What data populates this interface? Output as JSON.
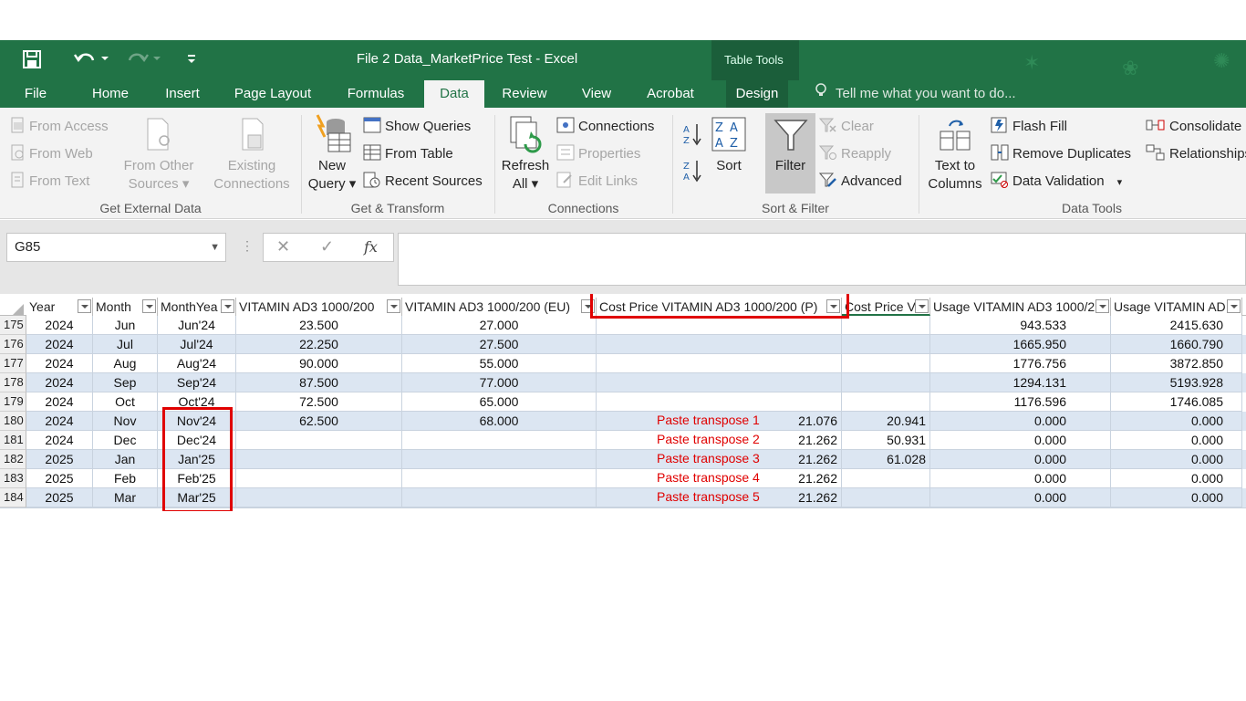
{
  "window": {
    "title": "File 2 Data_MarketPrice Test - Excel",
    "contextual_tab_group": "Table Tools"
  },
  "tabs": [
    "File",
    "Home",
    "Insert",
    "Page Layout",
    "Formulas",
    "Data",
    "Review",
    "View",
    "Acrobat",
    "Design"
  ],
  "active_tab": "Data",
  "tell_me": "Tell me what you want to do...",
  "ribbon": {
    "get_external": {
      "label": "Get External Data",
      "from_access": "From Access",
      "from_web": "From Web",
      "from_text": "From Text",
      "from_other_1": "From Other",
      "from_other_2": "Sources",
      "existing_1": "Existing",
      "existing_2": "Connections"
    },
    "get_transform": {
      "label": "Get & Transform",
      "new_query_1": "New",
      "new_query_2": "Query",
      "show_queries": "Show Queries",
      "from_table": "From Table",
      "recent_sources": "Recent Sources"
    },
    "connections": {
      "label": "Connections",
      "refresh_1": "Refresh",
      "refresh_2": "All",
      "connections": "Connections",
      "properties": "Properties",
      "edit_links": "Edit Links"
    },
    "sort_filter": {
      "label": "Sort & Filter",
      "sort": "Sort",
      "filter": "Filter",
      "clear": "Clear",
      "reapply": "Reapply",
      "advanced": "Advanced"
    },
    "data_tools": {
      "label": "Data Tools",
      "text_to_1": "Text to",
      "text_to_2": "Columns",
      "flash_fill": "Flash Fill",
      "remove_duplicates": "Remove Duplicates",
      "data_validation": "Data Validation",
      "consolidate": "Consolidate",
      "relationships": "Relationships"
    }
  },
  "formula_bar": {
    "name_box": "G85",
    "fx": "fx",
    "formula": ""
  },
  "headers": [
    "Year",
    "Month",
    "MonthYea",
    "VITAMIN AD3 1000/200",
    "VITAMIN AD3 1000/200 (EU)",
    "Cost Price VITAMIN AD3 1000/200 (P)",
    "Cost Price V",
    "Usage VITAMIN AD3 1000/2",
    "Usage VITAMIN AD"
  ],
  "rows": [
    {
      "rn": "175",
      "year": "2024",
      "month": "Jun",
      "my": "Jun'24",
      "v1": "23.500",
      "v2": "27.000",
      "note": "",
      "cp": "",
      "cpv": "",
      "u1": "943.533",
      "u2": "2415.630"
    },
    {
      "rn": "176",
      "year": "2024",
      "month": "Jul",
      "my": "Jul'24",
      "v1": "22.250",
      "v2": "27.500",
      "note": "",
      "cp": "",
      "cpv": "",
      "u1": "1665.950",
      "u2": "1660.790"
    },
    {
      "rn": "177",
      "year": "2024",
      "month": "Aug",
      "my": "Aug'24",
      "v1": "90.000",
      "v2": "55.000",
      "note": "",
      "cp": "",
      "cpv": "",
      "u1": "1776.756",
      "u2": "3872.850"
    },
    {
      "rn": "178",
      "year": "2024",
      "month": "Sep",
      "my": "Sep'24",
      "v1": "87.500",
      "v2": "77.000",
      "note": "",
      "cp": "",
      "cpv": "",
      "u1": "1294.131",
      "u2": "5193.928"
    },
    {
      "rn": "179",
      "year": "2024",
      "month": "Oct",
      "my": "Oct'24",
      "v1": "72.500",
      "v2": "65.000",
      "note": "",
      "cp": "",
      "cpv": "",
      "u1": "1176.596",
      "u2": "1746.085"
    },
    {
      "rn": "180",
      "year": "2024",
      "month": "Nov",
      "my": "Nov'24",
      "v1": "62.500",
      "v2": "68.000",
      "note": "Paste transpose 1",
      "cp": "21.076",
      "cpv": "20.941",
      "u1": "0.000",
      "u2": "0.000"
    },
    {
      "rn": "181",
      "year": "2024",
      "month": "Dec",
      "my": "Dec'24",
      "v1": "",
      "v2": "",
      "note": "Paste transpose 2",
      "cp": "21.262",
      "cpv": "50.931",
      "u1": "0.000",
      "u2": "0.000"
    },
    {
      "rn": "182",
      "year": "2025",
      "month": "Jan",
      "my": "Jan'25",
      "v1": "",
      "v2": "",
      "note": "Paste transpose 3",
      "cp": "21.262",
      "cpv": "61.028",
      "u1": "0.000",
      "u2": "0.000"
    },
    {
      "rn": "183",
      "year": "2025",
      "month": "Feb",
      "my": "Feb'25",
      "v1": "",
      "v2": "",
      "note": "Paste transpose 4",
      "cp": "21.262",
      "cpv": "",
      "u1": "0.000",
      "u2": "0.000"
    },
    {
      "rn": "184",
      "year": "2025",
      "month": "Mar",
      "my": "Mar'25",
      "v1": "",
      "v2": "",
      "note": "Paste transpose 5",
      "cp": "21.262",
      "cpv": "",
      "u1": "0.000",
      "u2": "0.000"
    }
  ],
  "colors": {
    "excel_green": "#217346",
    "band_blue": "#dce6f2",
    "annotation_red": "#e00000"
  }
}
